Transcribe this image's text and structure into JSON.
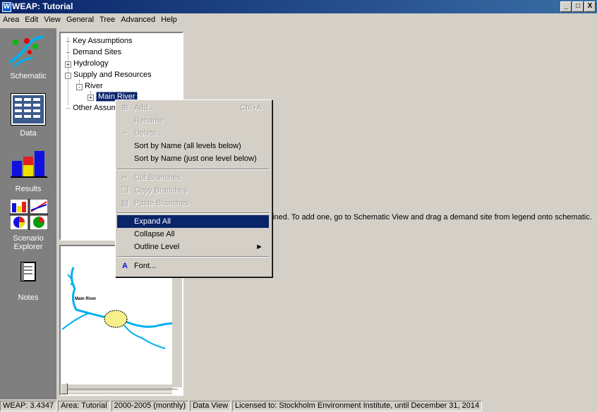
{
  "window": {
    "title": "WEAP: Tutorial",
    "icon_letter": "W",
    "controls": [
      "_",
      "□",
      "X"
    ]
  },
  "menu": [
    "Area",
    "Edit",
    "View",
    "General",
    "Tree",
    "Advanced",
    "Help"
  ],
  "sidebar": {
    "items": [
      {
        "label": "Schematic",
        "icon": "schematic-icon"
      },
      {
        "label": "Data",
        "icon": "data-icon"
      },
      {
        "label": "Results",
        "icon": "results-icon"
      },
      {
        "label": "Scenario Explorer",
        "icon": "scenario-explorer-icon"
      },
      {
        "label": "Notes",
        "icon": "notes-icon"
      }
    ]
  },
  "tree": {
    "items": [
      {
        "label": "Key Assumptions",
        "level": 0,
        "expander": ""
      },
      {
        "label": "Demand Sites",
        "level": 0,
        "expander": ""
      },
      {
        "label": "Hydrology",
        "level": 0,
        "expander": "+"
      },
      {
        "label": "Supply and Resources",
        "level": 0,
        "expander": "-"
      },
      {
        "label": "River",
        "level": 1,
        "expander": "-"
      },
      {
        "label": "Main River",
        "level": 2,
        "expander": "+",
        "selected": true
      },
      {
        "label": "Other Assum",
        "level": 0,
        "expander": ""
      }
    ]
  },
  "map": {
    "label": "Main River"
  },
  "context_menu": {
    "items": [
      {
        "label": "Add...",
        "shortcut": "Ctrl+A",
        "disabled": true,
        "icon": "add-icon"
      },
      {
        "label": "Rename",
        "disabled": true
      },
      {
        "label": "Delete...",
        "disabled": true,
        "icon": "delete-icon"
      },
      {
        "label": "Sort by Name (all levels below)",
        "disabled": false
      },
      {
        "label": "Sort by Name (just one level below)",
        "disabled": false
      },
      {
        "label": "Cut Branches",
        "disabled": true,
        "icon": "cut-icon"
      },
      {
        "label": "Copy Branches",
        "disabled": true,
        "icon": "copy-icon"
      },
      {
        "label": "Paste Branches",
        "disabled": true,
        "icon": "paste-icon"
      },
      {
        "label": "Expand All",
        "highlighted": true
      },
      {
        "label": "Collapse All"
      },
      {
        "label": "Outline Level",
        "submenu": true
      },
      {
        "label": "Font...",
        "icon": "font-icon"
      }
    ]
  },
  "content": {
    "message": "fined.  To add one, go to Schematic View and drag a demand site from legend onto schematic."
  },
  "statusbar": {
    "version": "WEAP: 3.4347",
    "area": "Area: Tutorial",
    "period": "2000-2005 (monthly)",
    "view": "Data View",
    "license": "Licensed to: Stockholm Environment Institute, until December 31, 2014"
  },
  "colors": {
    "title_bar": "#0a246a",
    "highlight": "#0a246a",
    "sidebar": "#7f7f7f",
    "river": "#00b0f0"
  }
}
